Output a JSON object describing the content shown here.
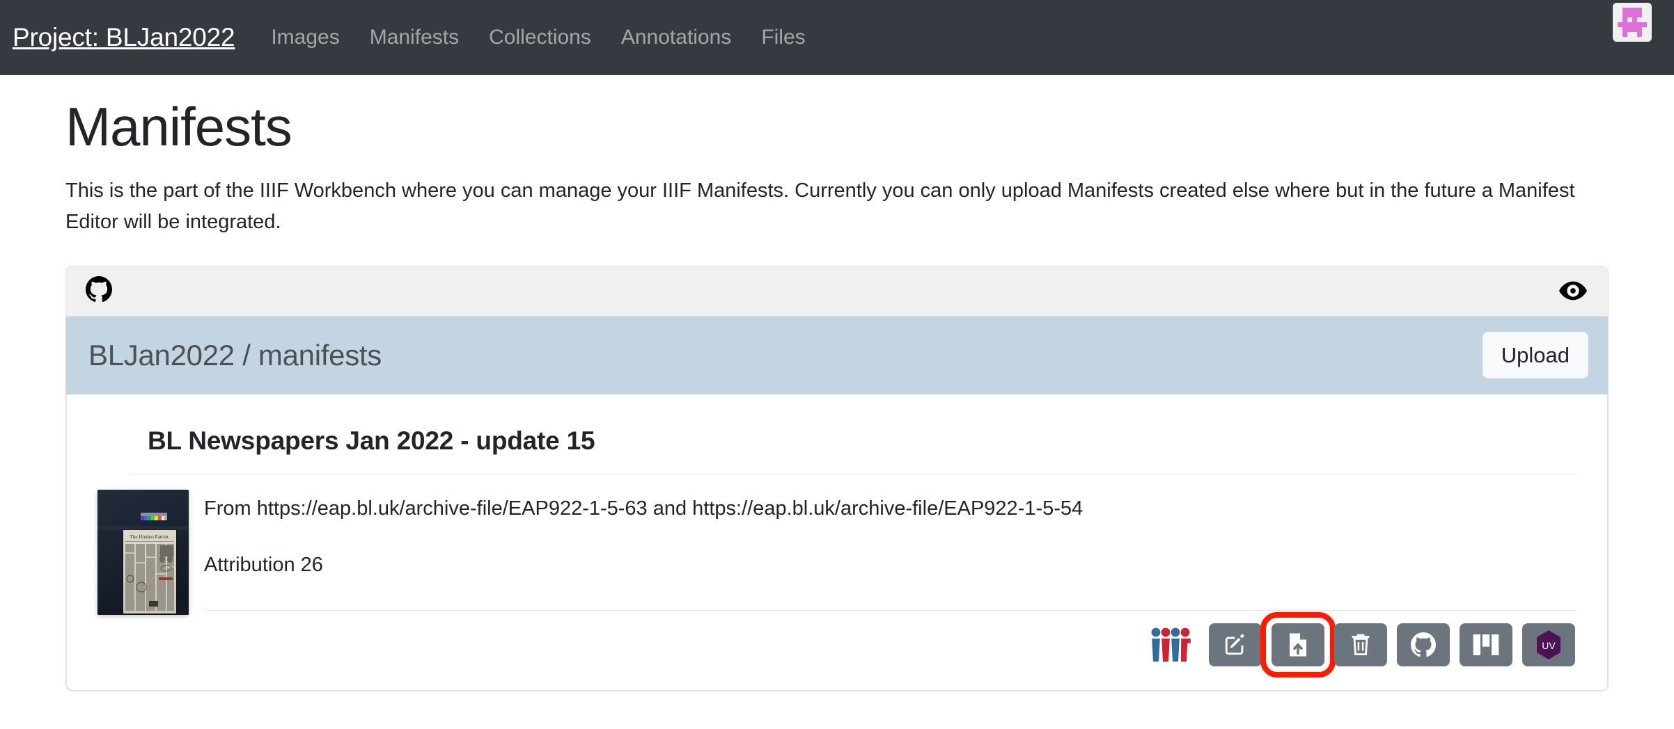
{
  "navbar": {
    "brand": "Project: BLJan2022",
    "links": [
      {
        "label": "Images",
        "name": "nav-link-images"
      },
      {
        "label": "Manifests",
        "name": "nav-link-manifests"
      },
      {
        "label": "Collections",
        "name": "nav-link-collections"
      },
      {
        "label": "Annotations",
        "name": "nav-link-annotations"
      },
      {
        "label": "Files",
        "name": "nav-link-files"
      }
    ],
    "avatar_icon": "user-identicon-avatar",
    "background_color": "#343a40",
    "avatar_accent_color": "#dd6fd8"
  },
  "page": {
    "title": "Manifests",
    "intro": "This is the part of the IIIF Workbench where you can manage your IIIF Manifests. Currently you can only upload Manifests created else where but in the future a Manifest Editor will be integrated."
  },
  "repo_card": {
    "header_icon": "github-icon",
    "visibility_icon": "eye-icon",
    "repo_path": "BLJan2022 / manifests",
    "upload_label": "Upload",
    "bar_color": "#c3d4e2",
    "header_color": "#f0f0f0"
  },
  "manifest": {
    "title": "BL Newspapers Jan 2022 - update 15",
    "thumbnail_alt": "The Hindoo Patriot newspaper page photographed on dark blue backdrop",
    "source_line": "From https://eap.bl.uk/archive-file/EAP922-1-5-63 and https://eap.bl.uk/archive-file/EAP922-1-5-54",
    "attribution_line": "Attribution 26",
    "actions": [
      {
        "name": "iiif-logo-icon",
        "label": "IIIF",
        "kind": "logo",
        "highlighted": false
      },
      {
        "name": "edit-manifest-button",
        "label": "Edit",
        "kind": "pencil-square-icon",
        "highlighted": false
      },
      {
        "name": "upload-manifest-button",
        "label": "Upload file",
        "kind": "file-upload-icon",
        "highlighted": true
      },
      {
        "name": "delete-manifest-button",
        "label": "Delete",
        "kind": "trash-icon",
        "highlighted": false
      },
      {
        "name": "github-manifest-button",
        "label": "GitHub",
        "kind": "github-icon",
        "highlighted": false
      },
      {
        "name": "mirador-viewer-button",
        "label": "Mirador",
        "kind": "mirador-icon",
        "highlighted": false
      },
      {
        "name": "universal-viewer-button",
        "label": "UV",
        "kind": "uv-hexagon-icon",
        "highlighted": false
      }
    ],
    "button_color": "#6c757d",
    "highlight_color": "#ff1a00",
    "uv_hex_color": "#4b1254"
  }
}
